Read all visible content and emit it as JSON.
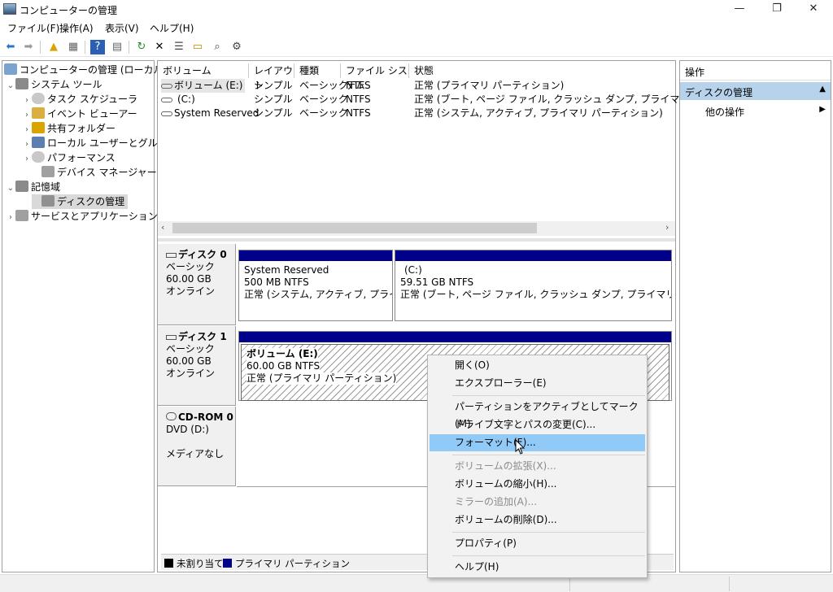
{
  "window": {
    "title": "コンピューターの管理",
    "minimize": "—",
    "maximize": "❐",
    "close": "✕"
  },
  "menu": [
    "ファイル(F)",
    "操作(A)",
    "表示(V)",
    "ヘルプ(H)"
  ],
  "toolbar_icons": [
    "back-arrow-icon",
    "forward-arrow-icon",
    "up-folder-icon",
    "show-hide-tree-icon",
    "help-icon",
    "show-hide-action-pane-icon",
    "refresh-icon",
    "delete-icon",
    "properties-icon",
    "open-icon",
    "search-icon",
    "settings-icon"
  ],
  "tree": {
    "root": "コンピューターの管理 (ローカル)",
    "system_tools": "システム ツール",
    "task_scheduler": "タスク スケジューラ",
    "event_viewer": "イベント ビューアー",
    "shared_folders": "共有フォルダー",
    "local_users": "ローカル ユーザーとグループ",
    "performance": "パフォーマンス",
    "device_manager": "デバイス マネージャー",
    "storage": "記憶域",
    "disk_management": "ディスクの管理",
    "services_apps": "サービスとアプリケーション"
  },
  "volume_table": {
    "headers": [
      "ボリューム",
      "レイアウト",
      "種類",
      "ファイル システム",
      "状態"
    ],
    "rows": [
      [
        "ボリューム (E:)",
        "シンプル",
        "ベーシック",
        "NTFS",
        "正常 (プライマリ パーティション)"
      ],
      [
        "(C:)",
        "シンプル",
        "ベーシック",
        "NTFS",
        "正常 (ブート, ページ ファイル, クラッシュ ダンプ, プライマリ パーティション)"
      ],
      [
        "System Reserved",
        "シンプル",
        "ベーシック",
        "NTFS",
        "正常 (システム, アクティブ, プライマリ パーティション)"
      ]
    ]
  },
  "disks": {
    "disk0": {
      "name": "ディスク 0",
      "type": "ベーシック",
      "size": "60.00 GB",
      "status": "オンライン",
      "partitions": [
        {
          "name": "System Reserved",
          "size": "500 MB NTFS",
          "status": "正常 (システム, アクティブ, プライマリ パ"
        },
        {
          "name": "(C:)",
          "size": "59.51 GB NTFS",
          "status": "正常 (ブート, ページ ファイル, クラッシュ ダンプ, プライマリ パーティション)"
        }
      ]
    },
    "disk1": {
      "name": "ディスク 1",
      "type": "ベーシック",
      "size": "60.00 GB",
      "status": "オンライン",
      "partition": {
        "name": "ボリューム (E:)",
        "size": "60.00 GB NTFS",
        "status": "正常 (プライマリ パーティション)"
      }
    },
    "cdrom0": {
      "name": "CD-ROM 0",
      "drive": "DVD (D:)",
      "status": "メディアなし"
    }
  },
  "legend": {
    "unallocated": "未割り当て",
    "primary": "プライマリ パーティション"
  },
  "actions": {
    "header": "操作",
    "section": "ディスクの管理",
    "more": "他の操作"
  },
  "context_menu": {
    "open": "開く(O)",
    "explore": "エクスプローラー(E)",
    "mark_active": "パーティションをアクティブとしてマーク(M)",
    "change_letter": "ドライブ文字とパスの変更(C)...",
    "format": "フォーマット(F)...",
    "extend": "ボリュームの拡張(X)...",
    "shrink": "ボリュームの縮小(H)...",
    "add_mirror": "ミラーの追加(A)...",
    "delete": "ボリュームの削除(D)...",
    "properties": "プロパティ(P)",
    "help": "ヘルプ(H)"
  },
  "colors": {
    "primary_partition": "#00008b",
    "unallocated": "#000000",
    "menu_highlight": "#91c9f7",
    "actions_section": "#b7d3ec"
  }
}
